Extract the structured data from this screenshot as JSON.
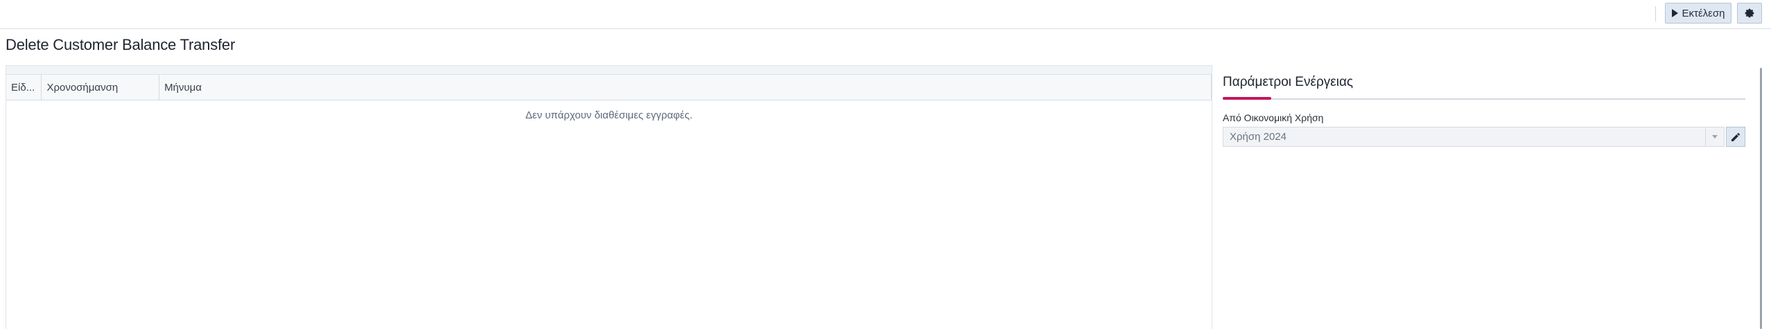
{
  "toolbar": {
    "run_label": "Εκτέλεση",
    "run_icon": "play-icon",
    "settings_icon": "gear-icon"
  },
  "page": {
    "title": "Delete Customer Balance Transfer"
  },
  "grid": {
    "columns": [
      "Είδ...",
      "Χρονοσήμανση",
      "Μήνυμα"
    ],
    "empty_message": "Δεν υπάρχουν διαθέσιμες εγγραφές."
  },
  "params": {
    "title": "Παράμετροι Ενέργειας",
    "accent_color": "#c2185b",
    "field": {
      "label": "Από Οικονομική Χρήση",
      "value": "Χρήση 2024",
      "edit_icon": "pencil-icon"
    }
  }
}
